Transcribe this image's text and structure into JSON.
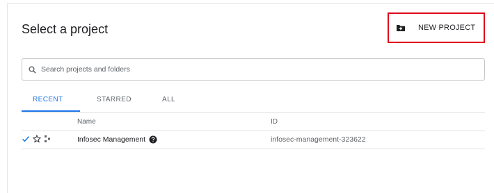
{
  "dialog": {
    "title": "Select a project",
    "new_project_label": "NEW PROJECT"
  },
  "search": {
    "placeholder": "Search projects and folders",
    "value": ""
  },
  "tabs": [
    {
      "label": "RECENT",
      "active": true
    },
    {
      "label": "STARRED",
      "active": false
    },
    {
      "label": "ALL",
      "active": false
    }
  ],
  "table": {
    "columns": [
      "Name",
      "ID"
    ],
    "rows": [
      {
        "name": "Infosec Management",
        "id": "infosec-management-323622",
        "selected": true,
        "starred": false
      }
    ]
  },
  "colors": {
    "accent": "#1a73e8",
    "highlight_border": "#e0001b"
  },
  "icons": [
    "new-folder-icon",
    "search-icon",
    "checkmark-icon",
    "star-outline-icon",
    "project-tree-icon",
    "help-icon"
  ]
}
